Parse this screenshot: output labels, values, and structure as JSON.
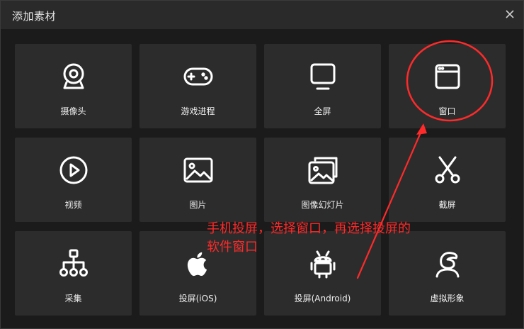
{
  "dialog": {
    "title": "添加素材",
    "close_icon": "close-icon"
  },
  "tiles": [
    {
      "label": "摄像头",
      "icon": "webcam-icon"
    },
    {
      "label": "游戏进程",
      "icon": "gamepad-icon"
    },
    {
      "label": "全屏",
      "icon": "monitor-icon"
    },
    {
      "label": "窗口",
      "icon": "window-icon"
    },
    {
      "label": "视频",
      "icon": "play-icon"
    },
    {
      "label": "图片",
      "icon": "image-icon"
    },
    {
      "label": "图像幻灯片",
      "icon": "slideshow-icon"
    },
    {
      "label": "截屏",
      "icon": "scissors-icon"
    },
    {
      "label": "采集",
      "icon": "hierarchy-icon"
    },
    {
      "label": "投屏(iOS)",
      "icon": "apple-icon"
    },
    {
      "label": "投屏(Android)",
      "icon": "android-icon"
    },
    {
      "label": "虚拟形象",
      "icon": "avatar-icon"
    }
  ],
  "annotation": {
    "line1": "手机投屏，选择窗口，再选择投屏的",
    "line2": "软件窗口",
    "color": "#ff2a2a"
  },
  "colors": {
    "background": "#1b1b1b",
    "titlebar": "#2a2a2a",
    "tile": "#2c2c2c",
    "annotation": "#ff2a2a"
  }
}
